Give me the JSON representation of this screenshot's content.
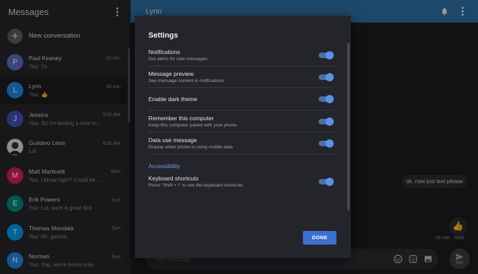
{
  "sidebar": {
    "title": "Messages",
    "new_conversation": "New conversation",
    "conversations": [
      {
        "name": "Paul Keaney",
        "snippet": "You: Yo",
        "time": "16 min",
        "initial": "P",
        "color": "#5c6bc0"
      },
      {
        "name": "Lynn",
        "snippet": "You: 👍",
        "time": "28 min",
        "initial": "L",
        "color": "#1e88e5"
      },
      {
        "name": "Jessica",
        "snippet": "You: So I'm testing a new m...",
        "time": "9:50 AM",
        "initial": "J",
        "color": "#3f51b5"
      },
      {
        "name": "Gustavo Leon",
        "snippet": "Lol",
        "time": "6:50 AM",
        "initial": "",
        "color": "#444"
      },
      {
        "name": "Matt Martinelli",
        "snippet": "You: I know right? Could be ...",
        "time": "Mon",
        "initial": "M",
        "color": "#d81b60"
      },
      {
        "name": "Erik Powers",
        "snippet": "You: Lol, such a great flick",
        "time": "Sun",
        "initial": "E",
        "color": "#00897b"
      },
      {
        "name": "Thomas Mondala",
        "snippet": "You: Ah, gotcha.",
        "time": "Sun",
        "initial": "T",
        "color": "#039be5"
      },
      {
        "name": "Norman",
        "snippet": "You: Yup, we're home now.",
        "time": "Sun",
        "initial": "N",
        "color": "#1e88e5"
      }
    ]
  },
  "conversation": {
    "title": "Lynn",
    "message_text": "ok, now just text please",
    "message_emoji": "👍",
    "meta": "28 min · SMS",
    "compose_placeholder": "Text message",
    "send_label": "SMS"
  },
  "settings": {
    "title": "Settings",
    "items": [
      {
        "title": "Notifications",
        "desc": "Get alerts for new messages",
        "on": true
      },
      {
        "title": "Message preview",
        "desc": "See message content in notifications",
        "on": true
      },
      {
        "title": "Enable dark theme",
        "desc": "",
        "on": true
      },
      {
        "title": "Remember this computer",
        "desc": "Keep this computer paired with your phone",
        "on": true
      },
      {
        "title": "Data use message",
        "desc": "Display when phone is using mobile data",
        "on": true
      }
    ],
    "section_accessibility": "Accessibility",
    "accessibility_items": [
      {
        "title": "Keyboard shortcuts",
        "desc": "Press \"Shift + /\" to see the keyboard shortcuts",
        "on": true
      }
    ],
    "done_label": "DONE"
  },
  "colors": {
    "accent": "#2f6fa3",
    "toggle_on": "#5b93ea",
    "done_button": "#3b70d1"
  }
}
